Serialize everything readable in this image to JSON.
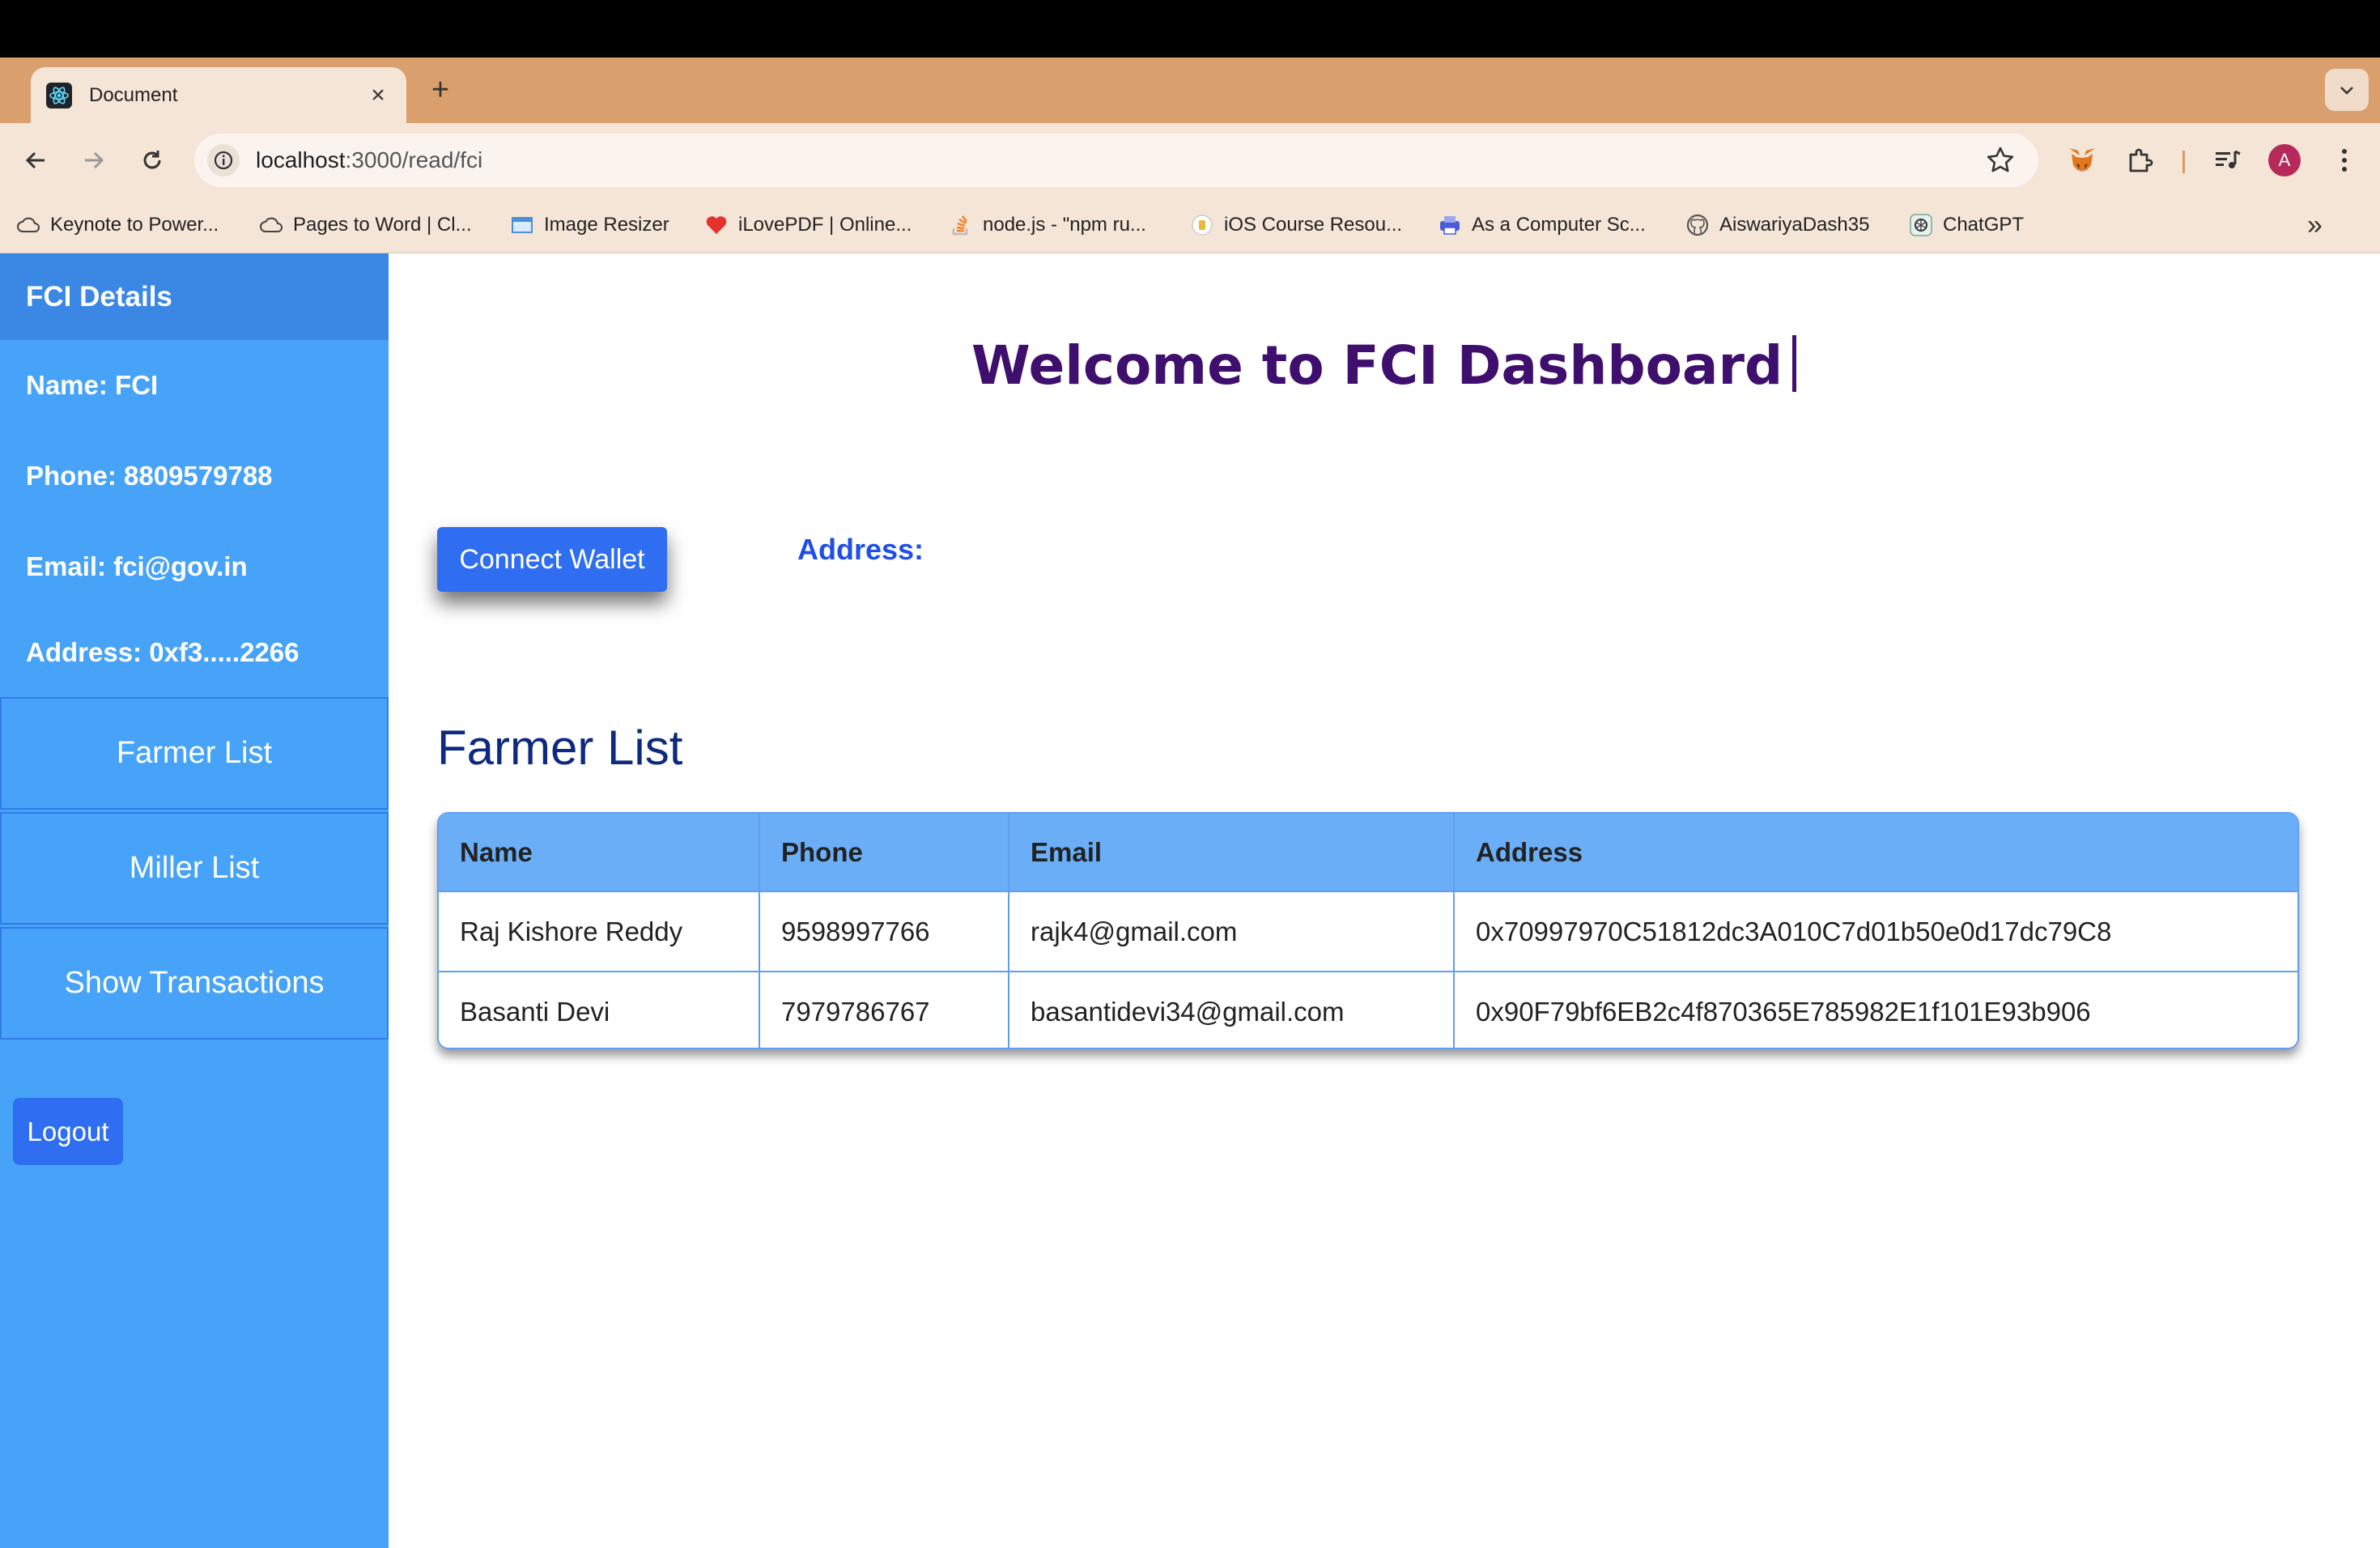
{
  "browser": {
    "tab_title": "Document",
    "url_host": "localhost",
    "url_path": ":3000/read/fci",
    "avatar_letter": "A",
    "bookmarks": [
      {
        "label": "Keynote to Power..."
      },
      {
        "label": "Pages to Word | Cl..."
      },
      {
        "label": "Image Resizer"
      },
      {
        "label": "iLovePDF | Online..."
      },
      {
        "label": "node.js - \"npm ru..."
      },
      {
        "label": "iOS Course Resou..."
      },
      {
        "label": "As a Computer Sc..."
      },
      {
        "label": "AiswariyaDash35"
      },
      {
        "label": "ChatGPT"
      }
    ]
  },
  "sidebar": {
    "title": "FCI Details",
    "name": "Name: FCI",
    "phone": "Phone: 8809579788",
    "email": "Email: fci@gov.in",
    "address": "Address: 0xf3.....2266",
    "buttons": [
      "Farmer List",
      "Miller List",
      "Show Transactions"
    ],
    "logout": "Logout"
  },
  "main": {
    "welcome": "Welcome to FCI Dashboard",
    "connect_wallet": "Connect Wallet",
    "address_label": "Address:",
    "section_title": "Farmer List",
    "table": {
      "headers": [
        "Name",
        "Phone",
        "Email",
        "Address"
      ],
      "rows": [
        [
          "Raj Kishore Reddy",
          "9598997766",
          "rajk4@gmail.com",
          "0x70997970C51812dc3A010C7d01b50e0d17dc79C8"
        ],
        [
          "Basanti Devi",
          "7979786767",
          "basantidevi34@gmail.com",
          "0x90F79bf6EB2c4f870365E785982E1f101E93b906"
        ]
      ]
    }
  }
}
